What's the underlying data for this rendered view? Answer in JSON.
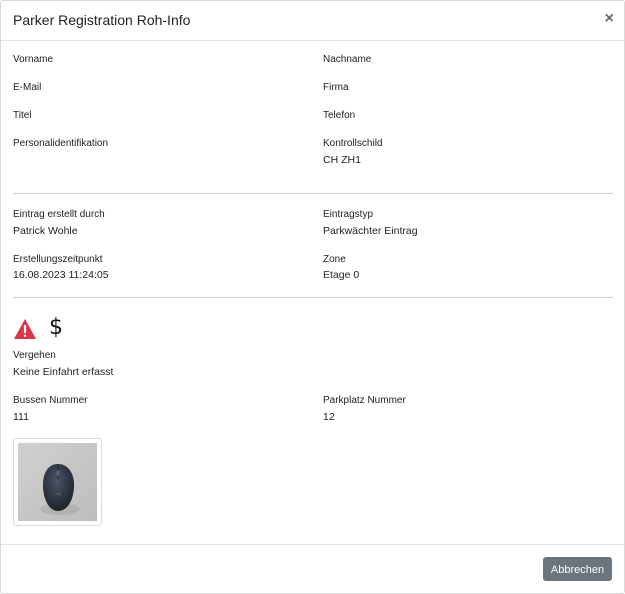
{
  "dialog": {
    "title": "Parker Registration Roh-Info",
    "close_glyph": "×"
  },
  "personal": {
    "first_name_label": "Vorname",
    "last_name_label": "Nachname",
    "email_label": "E-Mail",
    "company_label": "Firma",
    "title_label": "Titel",
    "phone_label": "Telefon",
    "personal_id_label": "Personalidentifikation",
    "plate_label": "Kontrollschild",
    "plate_value": "CH ZH1"
  },
  "entry": {
    "created_by_label": "Eintrag erstellt durch",
    "created_by_value": "Patrick Wohle",
    "entry_type_label": "Eintragstyp",
    "entry_type_value": "Parkwächter Eintrag",
    "created_at_label": "Erstellungszeitpunkt",
    "created_at_value": "16.08.2023 11:24:05",
    "zone_label": "Zone",
    "zone_value": "Etage 0"
  },
  "violation": {
    "icons": [
      "warning-icon",
      "dollar-icon"
    ],
    "warning_color": "#dc3545",
    "dollar_glyph": "$",
    "offense_label": "Vergehen",
    "offense_value": "Keine Einfahrt erfasst",
    "fine_number_label": "Bussen Nummer",
    "fine_number_value": "111",
    "parking_number_label": "Parkplatz Nummer",
    "parking_number_value": "12"
  },
  "footer": {
    "cancel_label": "Abbrechen",
    "cancel_color": "#6c757d"
  }
}
